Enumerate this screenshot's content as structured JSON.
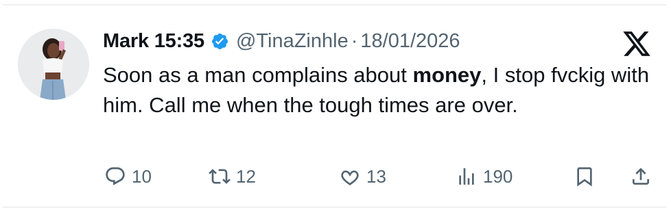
{
  "tweet": {
    "display_name": "Mark 15:35",
    "handle": "@TinaZinhle",
    "separator": "·",
    "date": "18/01/2026",
    "text_before": "Soon as a man complains about ",
    "text_bold": "money",
    "text_after": ", I stop fvckig with him. Call me when the tough times are over."
  },
  "actions": {
    "replies": "10",
    "retweets": "12",
    "likes": "13",
    "views": "190"
  },
  "colors": {
    "verified": "#1d9bf0",
    "text": "#0f1419",
    "muted": "#536471"
  },
  "icons": [
    "verified-badge-icon",
    "x-logo-icon",
    "reply-icon",
    "retweet-icon",
    "like-icon",
    "views-icon",
    "bookmark-icon",
    "share-icon"
  ]
}
